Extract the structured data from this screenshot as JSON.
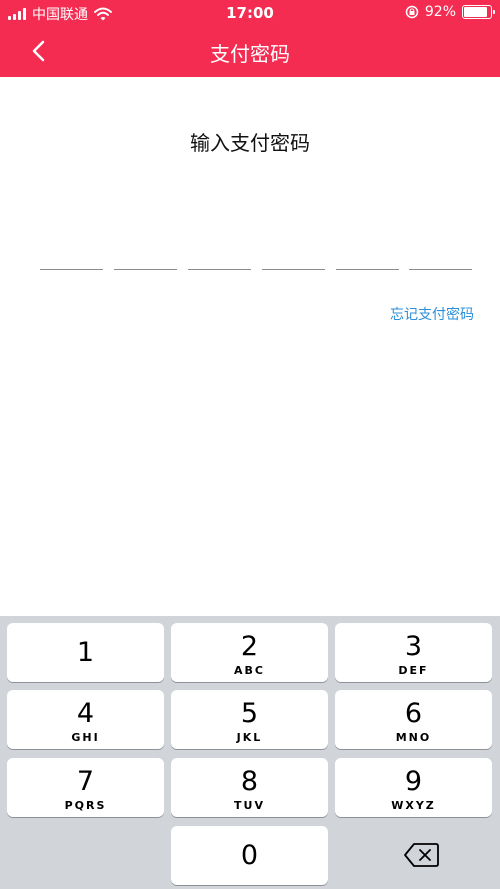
{
  "status_bar": {
    "carrier": "中国联通",
    "time": "17:00",
    "battery": "92%",
    "battery_level": 0.92
  },
  "nav": {
    "title": "支付密码",
    "back_icon": "chevron-left-icon"
  },
  "main": {
    "prompt": "输入支付密码",
    "pin_length": 6,
    "forgot_link": "忘记支付密码"
  },
  "keypad": {
    "keys": [
      {
        "digit": "1",
        "letters": ""
      },
      {
        "digit": "2",
        "letters": "ABC"
      },
      {
        "digit": "3",
        "letters": "DEF"
      },
      {
        "digit": "4",
        "letters": "GHI"
      },
      {
        "digit": "5",
        "letters": "JKL"
      },
      {
        "digit": "6",
        "letters": "MNO"
      },
      {
        "digit": "7",
        "letters": "PQRS"
      },
      {
        "digit": "8",
        "letters": "TUV"
      },
      {
        "digit": "9",
        "letters": "WXYZ"
      },
      {
        "digit": "0",
        "letters": ""
      }
    ],
    "delete_icon": "backspace-icon"
  },
  "colors": {
    "header": "#f42c52",
    "link": "#2b8fd8",
    "keypad_bg": "#d1d4d9"
  }
}
